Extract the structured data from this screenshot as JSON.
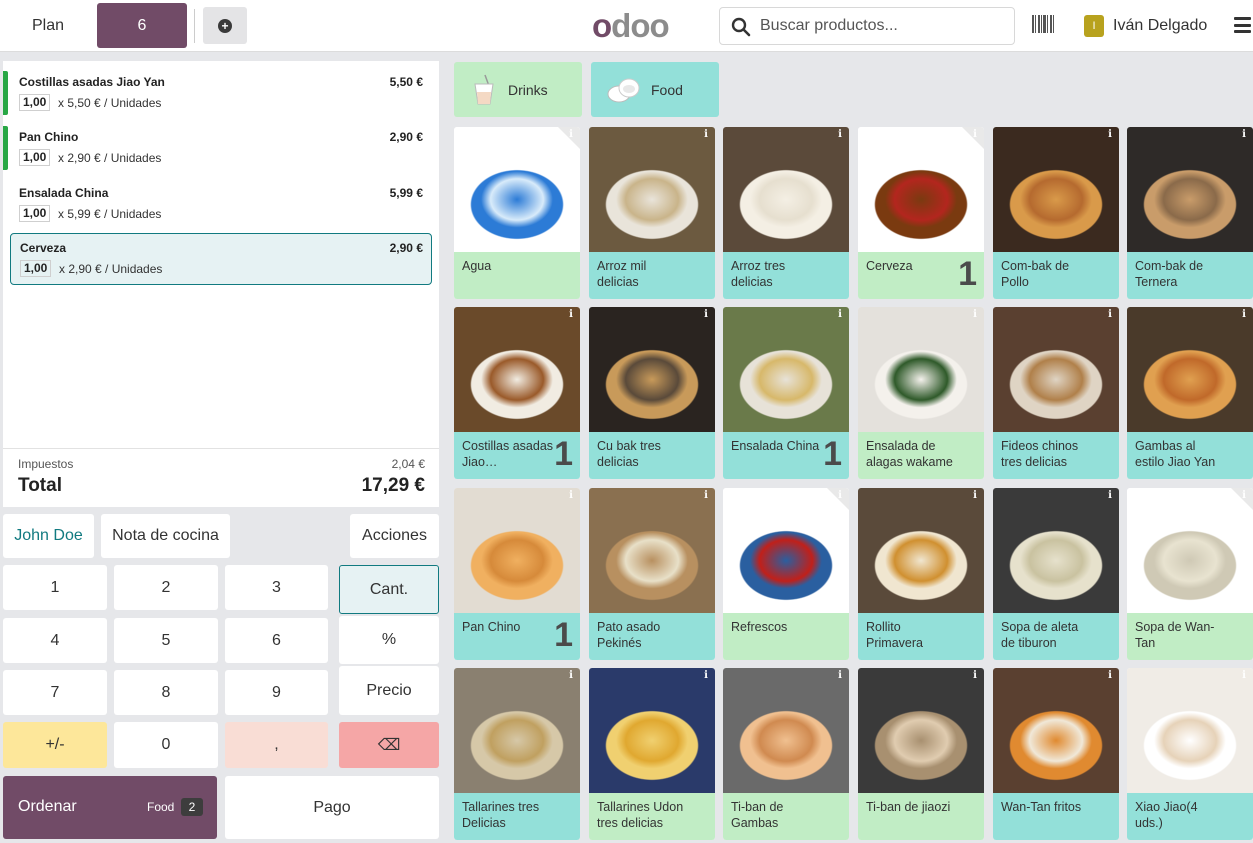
{
  "header": {
    "plan_label": "Plan",
    "table_number": "6",
    "add_icon": "plus-circle-icon",
    "logo_text": [
      "o",
      "d",
      "o",
      "o"
    ],
    "search_placeholder": "Buscar productos...",
    "barcode_icon": "barcode-icon",
    "user_initial": "I",
    "user_name": "Iván Delgado",
    "menu_icon": "hamburger-icon"
  },
  "order": {
    "lines": [
      {
        "name": "Costillas asadas Jiao Yan",
        "price": "5,50 €",
        "qty": "1,00",
        "unit": "x 5,50 € / Unidades",
        "sent": true
      },
      {
        "name": "Pan Chino",
        "price": "2,90 €",
        "qty": "1,00",
        "unit": "x 2,90 € / Unidades",
        "sent": true
      },
      {
        "name": "Ensalada China",
        "price": "5,99 €",
        "qty": "1,00",
        "unit": "x 5,99 € / Unidades",
        "sent": false
      },
      {
        "name": "Cerveza",
        "price": "2,90 €",
        "qty": "1,00",
        "unit": "x 2,90 € / Unidades",
        "sent": false,
        "selected": true
      }
    ],
    "tax_label": "Impuestos",
    "tax_value": "2,04 €",
    "total_label": "Total",
    "total_value": "17,29 €"
  },
  "controls": {
    "customer": "John Doe",
    "kitchen_note": "Nota de cocina",
    "actions": "Acciones",
    "keys": [
      "1",
      "2",
      "3",
      "4",
      "5",
      "6",
      "7",
      "8",
      "9",
      "+/-",
      "0",
      ","
    ],
    "mode_qty": "Cant.",
    "mode_disc": "%",
    "mode_price": "Precio",
    "backspace": "⌫",
    "order_label": "Ordenar",
    "order_category": "Food",
    "order_count": "2",
    "pay_label": "Pago"
  },
  "categories": [
    {
      "name": "Drinks",
      "icon": "drink-cup-icon",
      "color": "#c1edc5"
    },
    {
      "name": "Food",
      "icon": "food-plate-icon",
      "color": "#93e0d9"
    }
  ],
  "colors": {
    "brand": "#714b67",
    "accent": "#117a80",
    "drinks": "#c1edc5",
    "food": "#93e0d9",
    "sent_line": "#28a745"
  },
  "products": [
    {
      "name": "Agua",
      "cat": "drink",
      "qty": ""
    },
    {
      "name": "Arroz mil delicias",
      "cat": "food",
      "qty": ""
    },
    {
      "name": "Arroz tres delicias",
      "cat": "food",
      "qty": ""
    },
    {
      "name": "Cerveza",
      "cat": "drink",
      "qty": "1"
    },
    {
      "name": "Com-bak de Pollo",
      "cat": "food",
      "qty": ""
    },
    {
      "name": "Com-bak de Ternera",
      "cat": "food",
      "qty": ""
    },
    {
      "name": "Costillas asadas Jiao…",
      "cat": "food",
      "qty": "1"
    },
    {
      "name": "Cu bak tres delicias",
      "cat": "food",
      "qty": ""
    },
    {
      "name": "Ensalada China",
      "cat": "food",
      "qty": "1"
    },
    {
      "name": "Ensalada de alagas wakame",
      "cat": "drink",
      "qty": ""
    },
    {
      "name": "Fideos chinos tres delicias",
      "cat": "food",
      "qty": ""
    },
    {
      "name": "Gambas al estilo Jiao Yan",
      "cat": "food",
      "qty": ""
    },
    {
      "name": "Pan Chino",
      "cat": "food",
      "qty": "1"
    },
    {
      "name": "Pato asado Pekinés",
      "cat": "food",
      "qty": ""
    },
    {
      "name": "Refrescos",
      "cat": "drink",
      "qty": ""
    },
    {
      "name": "Rollito Primavera",
      "cat": "food",
      "qty": ""
    },
    {
      "name": "Sopa de aleta de tiburon",
      "cat": "food",
      "qty": ""
    },
    {
      "name": "Sopa de Wan-Tan",
      "cat": "drink",
      "qty": ""
    },
    {
      "name": "Tallarines tres Delicias",
      "cat": "food",
      "qty": ""
    },
    {
      "name": "Tallarines Udon tres delicias",
      "cat": "drink",
      "qty": ""
    },
    {
      "name": "Ti-ban de Gambas",
      "cat": "drink",
      "qty": ""
    },
    {
      "name": "Ti-ban de jiaozi",
      "cat": "drink",
      "qty": ""
    },
    {
      "name": "Wan-Tan fritos",
      "cat": "food",
      "qty": ""
    },
    {
      "name": "Xiao Jiao(4 uds.)",
      "cat": "food",
      "qty": ""
    }
  ]
}
